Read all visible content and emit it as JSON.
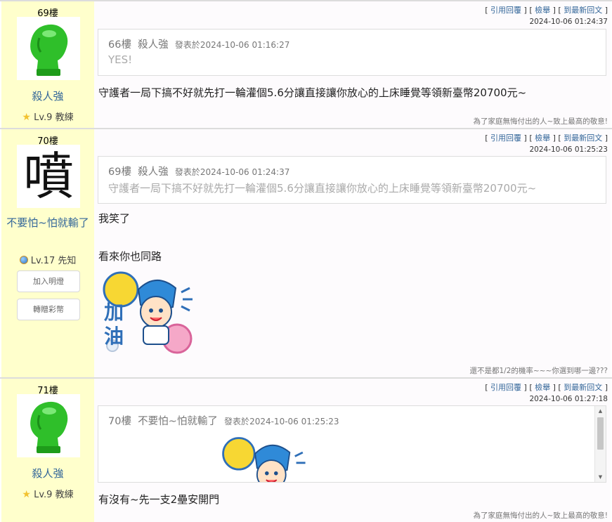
{
  "actions": {
    "quote": "引用回覆",
    "report": "檢舉",
    "latest": "到最新回文",
    "open_bracket": "[ ",
    "sep": " ] [ ",
    "close_bracket": " ]"
  },
  "posts": [
    {
      "floor": "69樓",
      "username": "殺人強",
      "level": "Lv.9 教練",
      "time": "2024-10-06 01:24:37",
      "quote": {
        "floor": "66樓",
        "author": "殺人強",
        "label": "發表於",
        "time": "2024-10-06 01:16:27",
        "text": "YES!"
      },
      "content": [
        "守護者一局下搞不好就先打一輪灌個5.6分讓直接讓你放心的上床睡覺等領新臺幣20700元~"
      ],
      "signature": "為了家庭無悔付出的人~致上最高的敬意!"
    },
    {
      "floor": "70樓",
      "username": "不要怕~怕就輸了",
      "level": "Lv.17 先知",
      "time": "2024-10-06 01:25:23",
      "buttons": [
        "加入明燈",
        "轉贈彩幣"
      ],
      "avatar_char": "噴",
      "sticker_text": "加油",
      "quote": {
        "floor": "69樓",
        "author": "殺人強",
        "label": "發表於",
        "time": "2024-10-06 01:24:37",
        "text": "守護者一局下搞不好就先打一輪灌個5.6分讓直接讓你放心的上床睡覺等領新臺幣20700元~"
      },
      "content": [
        "我笑了",
        "看來你也同路"
      ],
      "signature": "還不是都1/2的機率~~~你選到哪一邊???"
    },
    {
      "floor": "71樓",
      "username": "殺人強",
      "level": "Lv.9 教練",
      "time": "2024-10-06 01:27:18",
      "quote": {
        "floor": "70樓",
        "author": "不要怕~怕就輸了",
        "label": "發表於",
        "time": "2024-10-06 01:25:23",
        "text": ""
      },
      "content": [
        "有沒有~先一支2壘安開門"
      ],
      "signature": "為了家庭無悔付出的人~致上最高的敬意!"
    }
  ]
}
